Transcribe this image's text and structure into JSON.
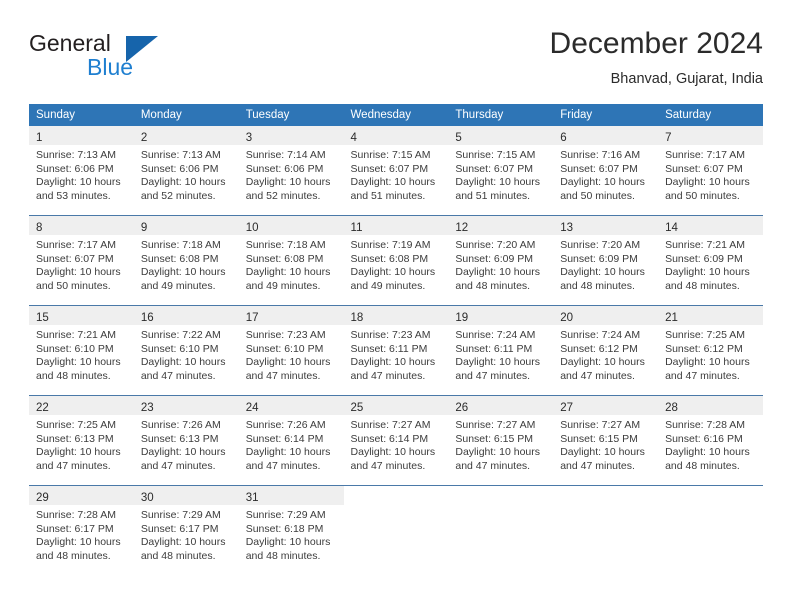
{
  "brand": {
    "name_top": "General",
    "name_bottom": "Blue",
    "flag_icon": "blue-triangle-flag",
    "color_dark": "#231f20",
    "color_blue": "#1f7fd0",
    "color_flag": "#1664ab"
  },
  "header": {
    "title": "December 2024",
    "subtitle": "Bhanvad, Gujarat, India"
  },
  "theme": {
    "header_bg": "#2e75b6",
    "header_text": "#ffffff",
    "daynum_band_bg": "#efefef",
    "row_divider": "#4a79a8",
    "body_text": "#3c3c3c"
  },
  "weekday_headers": [
    "Sunday",
    "Monday",
    "Tuesday",
    "Wednesday",
    "Thursday",
    "Friday",
    "Saturday"
  ],
  "weeks": [
    [
      {
        "day": "1",
        "sunrise": "Sunrise: 7:13 AM",
        "sunset": "Sunset: 6:06 PM",
        "daylight": "Daylight: 10 hours and 53 minutes."
      },
      {
        "day": "2",
        "sunrise": "Sunrise: 7:13 AM",
        "sunset": "Sunset: 6:06 PM",
        "daylight": "Daylight: 10 hours and 52 minutes."
      },
      {
        "day": "3",
        "sunrise": "Sunrise: 7:14 AM",
        "sunset": "Sunset: 6:06 PM",
        "daylight": "Daylight: 10 hours and 52 minutes."
      },
      {
        "day": "4",
        "sunrise": "Sunrise: 7:15 AM",
        "sunset": "Sunset: 6:07 PM",
        "daylight": "Daylight: 10 hours and 51 minutes."
      },
      {
        "day": "5",
        "sunrise": "Sunrise: 7:15 AM",
        "sunset": "Sunset: 6:07 PM",
        "daylight": "Daylight: 10 hours and 51 minutes."
      },
      {
        "day": "6",
        "sunrise": "Sunrise: 7:16 AM",
        "sunset": "Sunset: 6:07 PM",
        "daylight": "Daylight: 10 hours and 50 minutes."
      },
      {
        "day": "7",
        "sunrise": "Sunrise: 7:17 AM",
        "sunset": "Sunset: 6:07 PM",
        "daylight": "Daylight: 10 hours and 50 minutes."
      }
    ],
    [
      {
        "day": "8",
        "sunrise": "Sunrise: 7:17 AM",
        "sunset": "Sunset: 6:07 PM",
        "daylight": "Daylight: 10 hours and 50 minutes."
      },
      {
        "day": "9",
        "sunrise": "Sunrise: 7:18 AM",
        "sunset": "Sunset: 6:08 PM",
        "daylight": "Daylight: 10 hours and 49 minutes."
      },
      {
        "day": "10",
        "sunrise": "Sunrise: 7:18 AM",
        "sunset": "Sunset: 6:08 PM",
        "daylight": "Daylight: 10 hours and 49 minutes."
      },
      {
        "day": "11",
        "sunrise": "Sunrise: 7:19 AM",
        "sunset": "Sunset: 6:08 PM",
        "daylight": "Daylight: 10 hours and 49 minutes."
      },
      {
        "day": "12",
        "sunrise": "Sunrise: 7:20 AM",
        "sunset": "Sunset: 6:09 PM",
        "daylight": "Daylight: 10 hours and 48 minutes."
      },
      {
        "day": "13",
        "sunrise": "Sunrise: 7:20 AM",
        "sunset": "Sunset: 6:09 PM",
        "daylight": "Daylight: 10 hours and 48 minutes."
      },
      {
        "day": "14",
        "sunrise": "Sunrise: 7:21 AM",
        "sunset": "Sunset: 6:09 PM",
        "daylight": "Daylight: 10 hours and 48 minutes."
      }
    ],
    [
      {
        "day": "15",
        "sunrise": "Sunrise: 7:21 AM",
        "sunset": "Sunset: 6:10 PM",
        "daylight": "Daylight: 10 hours and 48 minutes."
      },
      {
        "day": "16",
        "sunrise": "Sunrise: 7:22 AM",
        "sunset": "Sunset: 6:10 PM",
        "daylight": "Daylight: 10 hours and 47 minutes."
      },
      {
        "day": "17",
        "sunrise": "Sunrise: 7:23 AM",
        "sunset": "Sunset: 6:10 PM",
        "daylight": "Daylight: 10 hours and 47 minutes."
      },
      {
        "day": "18",
        "sunrise": "Sunrise: 7:23 AM",
        "sunset": "Sunset: 6:11 PM",
        "daylight": "Daylight: 10 hours and 47 minutes."
      },
      {
        "day": "19",
        "sunrise": "Sunrise: 7:24 AM",
        "sunset": "Sunset: 6:11 PM",
        "daylight": "Daylight: 10 hours and 47 minutes."
      },
      {
        "day": "20",
        "sunrise": "Sunrise: 7:24 AM",
        "sunset": "Sunset: 6:12 PM",
        "daylight": "Daylight: 10 hours and 47 minutes."
      },
      {
        "day": "21",
        "sunrise": "Sunrise: 7:25 AM",
        "sunset": "Sunset: 6:12 PM",
        "daylight": "Daylight: 10 hours and 47 minutes."
      }
    ],
    [
      {
        "day": "22",
        "sunrise": "Sunrise: 7:25 AM",
        "sunset": "Sunset: 6:13 PM",
        "daylight": "Daylight: 10 hours and 47 minutes."
      },
      {
        "day": "23",
        "sunrise": "Sunrise: 7:26 AM",
        "sunset": "Sunset: 6:13 PM",
        "daylight": "Daylight: 10 hours and 47 minutes."
      },
      {
        "day": "24",
        "sunrise": "Sunrise: 7:26 AM",
        "sunset": "Sunset: 6:14 PM",
        "daylight": "Daylight: 10 hours and 47 minutes."
      },
      {
        "day": "25",
        "sunrise": "Sunrise: 7:27 AM",
        "sunset": "Sunset: 6:14 PM",
        "daylight": "Daylight: 10 hours and 47 minutes."
      },
      {
        "day": "26",
        "sunrise": "Sunrise: 7:27 AM",
        "sunset": "Sunset: 6:15 PM",
        "daylight": "Daylight: 10 hours and 47 minutes."
      },
      {
        "day": "27",
        "sunrise": "Sunrise: 7:27 AM",
        "sunset": "Sunset: 6:15 PM",
        "daylight": "Daylight: 10 hours and 47 minutes."
      },
      {
        "day": "28",
        "sunrise": "Sunrise: 7:28 AM",
        "sunset": "Sunset: 6:16 PM",
        "daylight": "Daylight: 10 hours and 48 minutes."
      }
    ],
    [
      {
        "day": "29",
        "sunrise": "Sunrise: 7:28 AM",
        "sunset": "Sunset: 6:17 PM",
        "daylight": "Daylight: 10 hours and 48 minutes."
      },
      {
        "day": "30",
        "sunrise": "Sunrise: 7:29 AM",
        "sunset": "Sunset: 6:17 PM",
        "daylight": "Daylight: 10 hours and 48 minutes."
      },
      {
        "day": "31",
        "sunrise": "Sunrise: 7:29 AM",
        "sunset": "Sunset: 6:18 PM",
        "daylight": "Daylight: 10 hours and 48 minutes."
      },
      null,
      null,
      null,
      null
    ]
  ]
}
